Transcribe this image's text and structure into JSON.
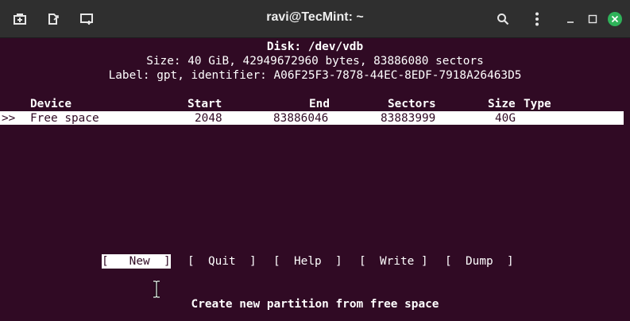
{
  "window": {
    "title": "ravi@TecMint: ~",
    "colors": {
      "background": "#300a24",
      "titlebar": "#2f2f2f",
      "close_button": "#2fb35a"
    },
    "titlebar_icons": [
      "new-tab-icon",
      "detach-tab-icon",
      "new-window-icon",
      "search-icon",
      "kebab-menu-icon",
      "minimize-icon",
      "maximize-icon",
      "close-icon"
    ]
  },
  "terminal": {
    "disk_line": "Disk: /dev/vdb",
    "size_line": "Size: 40 GiB, 42949672960 bytes, 83886080 sectors",
    "label_line": "Label: gpt, identifier: A06F25F3-7878-44EC-8EDF-7918A26463D5",
    "table": {
      "headers": {
        "device": "Device",
        "start": "Start",
        "end": "End",
        "sectors": "Sectors",
        "size": "Size",
        "type": "Type"
      },
      "rows": [
        {
          "marker": ">>",
          "device": "Free space",
          "start": "2048",
          "end": "83886046",
          "sectors": "83883999",
          "size": "40G",
          "type": ""
        }
      ]
    },
    "menu": [
      {
        "text": "[   New  ]",
        "selected": true
      },
      {
        "text": "[  Quit  ]",
        "selected": false
      },
      {
        "text": "[  Help  ]",
        "selected": false
      },
      {
        "text": "[  Write ]",
        "selected": false
      },
      {
        "text": "[  Dump  ]",
        "selected": false
      }
    ],
    "hint": "Create new partition from free space"
  }
}
